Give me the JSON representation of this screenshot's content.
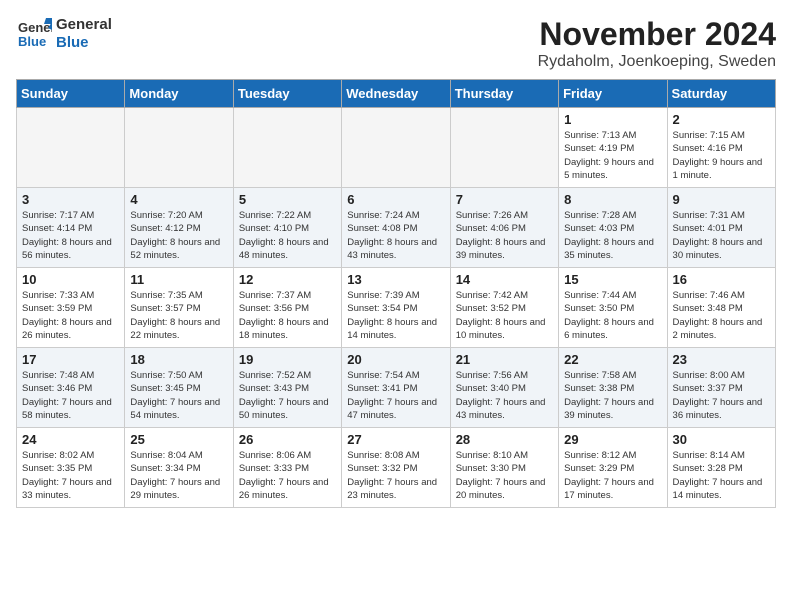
{
  "logo": {
    "line1": "General",
    "line2": "Blue"
  },
  "title": "November 2024",
  "location": "Rydaholm, Joenkoeping, Sweden",
  "weekdays": [
    "Sunday",
    "Monday",
    "Tuesday",
    "Wednesday",
    "Thursday",
    "Friday",
    "Saturday"
  ],
  "weeks": [
    [
      {
        "day": "",
        "info": "",
        "empty": true
      },
      {
        "day": "",
        "info": "",
        "empty": true
      },
      {
        "day": "",
        "info": "",
        "empty": true
      },
      {
        "day": "",
        "info": "",
        "empty": true
      },
      {
        "day": "",
        "info": "",
        "empty": true
      },
      {
        "day": "1",
        "info": "Sunrise: 7:13 AM\nSunset: 4:19 PM\nDaylight: 9 hours\nand 5 minutes."
      },
      {
        "day": "2",
        "info": "Sunrise: 7:15 AM\nSunset: 4:16 PM\nDaylight: 9 hours\nand 1 minute."
      }
    ],
    [
      {
        "day": "3",
        "info": "Sunrise: 7:17 AM\nSunset: 4:14 PM\nDaylight: 8 hours\nand 56 minutes.",
        "shaded": true
      },
      {
        "day": "4",
        "info": "Sunrise: 7:20 AM\nSunset: 4:12 PM\nDaylight: 8 hours\nand 52 minutes.",
        "shaded": true
      },
      {
        "day": "5",
        "info": "Sunrise: 7:22 AM\nSunset: 4:10 PM\nDaylight: 8 hours\nand 48 minutes.",
        "shaded": true
      },
      {
        "day": "6",
        "info": "Sunrise: 7:24 AM\nSunset: 4:08 PM\nDaylight: 8 hours\nand 43 minutes.",
        "shaded": true
      },
      {
        "day": "7",
        "info": "Sunrise: 7:26 AM\nSunset: 4:06 PM\nDaylight: 8 hours\nand 39 minutes.",
        "shaded": true
      },
      {
        "day": "8",
        "info": "Sunrise: 7:28 AM\nSunset: 4:03 PM\nDaylight: 8 hours\nand 35 minutes.",
        "shaded": true
      },
      {
        "day": "9",
        "info": "Sunrise: 7:31 AM\nSunset: 4:01 PM\nDaylight: 8 hours\nand 30 minutes.",
        "shaded": true
      }
    ],
    [
      {
        "day": "10",
        "info": "Sunrise: 7:33 AM\nSunset: 3:59 PM\nDaylight: 8 hours\nand 26 minutes."
      },
      {
        "day": "11",
        "info": "Sunrise: 7:35 AM\nSunset: 3:57 PM\nDaylight: 8 hours\nand 22 minutes."
      },
      {
        "day": "12",
        "info": "Sunrise: 7:37 AM\nSunset: 3:56 PM\nDaylight: 8 hours\nand 18 minutes."
      },
      {
        "day": "13",
        "info": "Sunrise: 7:39 AM\nSunset: 3:54 PM\nDaylight: 8 hours\nand 14 minutes."
      },
      {
        "day": "14",
        "info": "Sunrise: 7:42 AM\nSunset: 3:52 PM\nDaylight: 8 hours\nand 10 minutes."
      },
      {
        "day": "15",
        "info": "Sunrise: 7:44 AM\nSunset: 3:50 PM\nDaylight: 8 hours\nand 6 minutes."
      },
      {
        "day": "16",
        "info": "Sunrise: 7:46 AM\nSunset: 3:48 PM\nDaylight: 8 hours\nand 2 minutes."
      }
    ],
    [
      {
        "day": "17",
        "info": "Sunrise: 7:48 AM\nSunset: 3:46 PM\nDaylight: 7 hours\nand 58 minutes.",
        "shaded": true
      },
      {
        "day": "18",
        "info": "Sunrise: 7:50 AM\nSunset: 3:45 PM\nDaylight: 7 hours\nand 54 minutes.",
        "shaded": true
      },
      {
        "day": "19",
        "info": "Sunrise: 7:52 AM\nSunset: 3:43 PM\nDaylight: 7 hours\nand 50 minutes.",
        "shaded": true
      },
      {
        "day": "20",
        "info": "Sunrise: 7:54 AM\nSunset: 3:41 PM\nDaylight: 7 hours\nand 47 minutes.",
        "shaded": true
      },
      {
        "day": "21",
        "info": "Sunrise: 7:56 AM\nSunset: 3:40 PM\nDaylight: 7 hours\nand 43 minutes.",
        "shaded": true
      },
      {
        "day": "22",
        "info": "Sunrise: 7:58 AM\nSunset: 3:38 PM\nDaylight: 7 hours\nand 39 minutes.",
        "shaded": true
      },
      {
        "day": "23",
        "info": "Sunrise: 8:00 AM\nSunset: 3:37 PM\nDaylight: 7 hours\nand 36 minutes.",
        "shaded": true
      }
    ],
    [
      {
        "day": "24",
        "info": "Sunrise: 8:02 AM\nSunset: 3:35 PM\nDaylight: 7 hours\nand 33 minutes."
      },
      {
        "day": "25",
        "info": "Sunrise: 8:04 AM\nSunset: 3:34 PM\nDaylight: 7 hours\nand 29 minutes."
      },
      {
        "day": "26",
        "info": "Sunrise: 8:06 AM\nSunset: 3:33 PM\nDaylight: 7 hours\nand 26 minutes."
      },
      {
        "day": "27",
        "info": "Sunrise: 8:08 AM\nSunset: 3:32 PM\nDaylight: 7 hours\nand 23 minutes."
      },
      {
        "day": "28",
        "info": "Sunrise: 8:10 AM\nSunset: 3:30 PM\nDaylight: 7 hours\nand 20 minutes."
      },
      {
        "day": "29",
        "info": "Sunrise: 8:12 AM\nSunset: 3:29 PM\nDaylight: 7 hours\nand 17 minutes."
      },
      {
        "day": "30",
        "info": "Sunrise: 8:14 AM\nSunset: 3:28 PM\nDaylight: 7 hours\nand 14 minutes."
      }
    ]
  ]
}
